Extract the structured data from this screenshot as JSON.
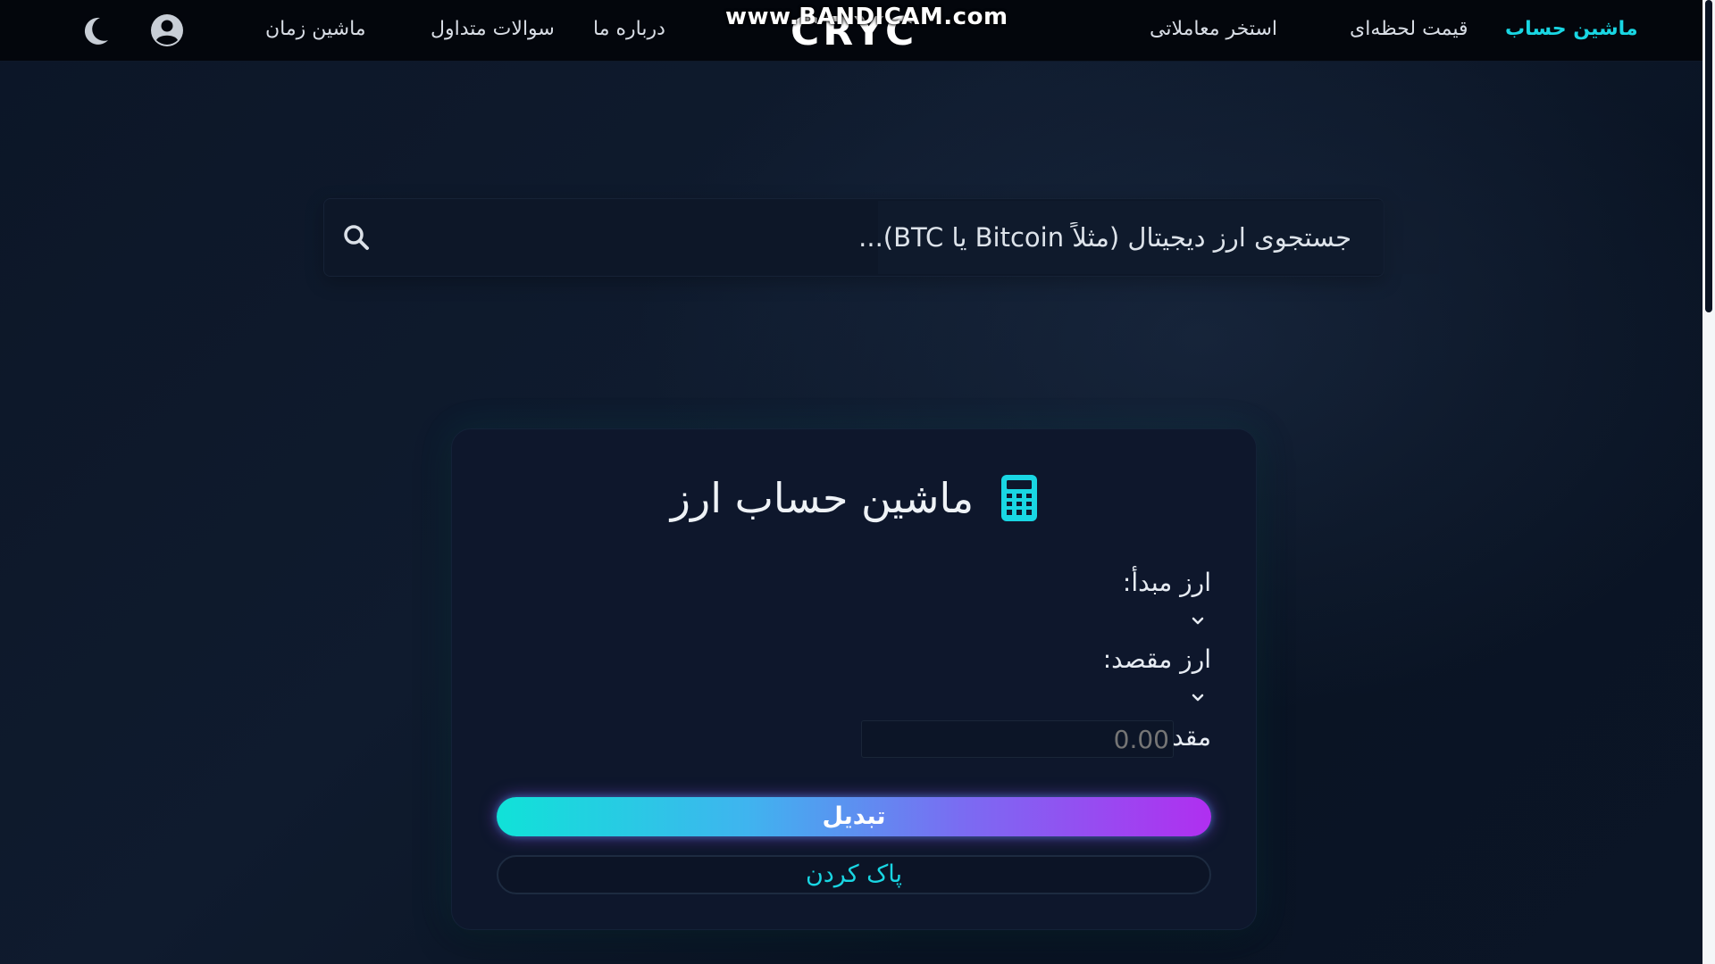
{
  "navbar": {
    "items": [
      {
        "label": "ماشین حساب",
        "active": true
      },
      {
        "label": "قیمت لحظه‌ای",
        "active": false
      },
      {
        "label": "استخر معاملاتی",
        "active": false
      },
      {
        "label": "درباره ما",
        "active": false
      },
      {
        "label": "سوالات متداول",
        "active": false
      },
      {
        "label": "ماشین زمان",
        "active": false
      }
    ],
    "logo": "CRYC",
    "watermark": "www.BANDICAM.com",
    "icons": [
      "user-icon",
      "moon-icon"
    ]
  },
  "search": {
    "placeholder": "جستجوی ارز دیجیتال (مثلاً Bitcoin یا BTC)..."
  },
  "converter": {
    "title": "ماشین حساب ارز",
    "source_label": "ارز مبدأ:",
    "target_label": "ارز مقصد:",
    "amount_label": "مقدار:",
    "amount_placeholder": "0.00",
    "convert_label": "تبدیل",
    "clear_label": "پاک کردن"
  },
  "colors": {
    "accent": "#19d6e3",
    "gradient_start": "#10e2d8",
    "gradient_end": "#b02ff0",
    "background": "#0a1322",
    "navbar": "#03060c"
  }
}
